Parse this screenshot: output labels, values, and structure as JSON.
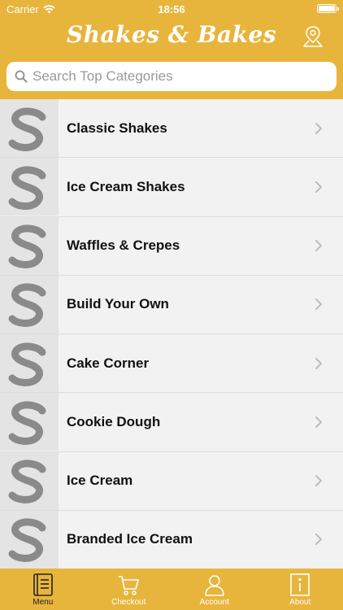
{
  "status_bar": {
    "carrier": "Carrier",
    "time": "18:56"
  },
  "header": {
    "title": "Shakes & Bakes",
    "location_icon": "map-pin-icon"
  },
  "search": {
    "placeholder": "Search Top Categories",
    "value": ""
  },
  "categories": [
    {
      "label": "Classic Shakes",
      "thumb": "S"
    },
    {
      "label": "Ice Cream Shakes",
      "thumb": "S"
    },
    {
      "label": "Waffles & Crepes",
      "thumb": "S"
    },
    {
      "label": "Build Your Own",
      "thumb": "S"
    },
    {
      "label": "Cake Corner",
      "thumb": "S"
    },
    {
      "label": "Cookie Dough",
      "thumb": "S"
    },
    {
      "label": "Ice Cream",
      "thumb": "S"
    },
    {
      "label": "Branded Ice Cream",
      "thumb": "S"
    }
  ],
  "tabs": [
    {
      "label": "Menu",
      "icon": "menu-book-icon",
      "active": true
    },
    {
      "label": "Checkout",
      "icon": "cart-icon",
      "active": false
    },
    {
      "label": "Account",
      "icon": "person-icon",
      "active": false
    },
    {
      "label": "About",
      "icon": "info-icon",
      "active": false
    }
  ],
  "colors": {
    "brand": "#e8b53c",
    "list_bg": "#f2f2f2",
    "thumb_letter": "#8a8a8a",
    "active_tab": "#222222",
    "inactive_tab": "#ffffff"
  }
}
